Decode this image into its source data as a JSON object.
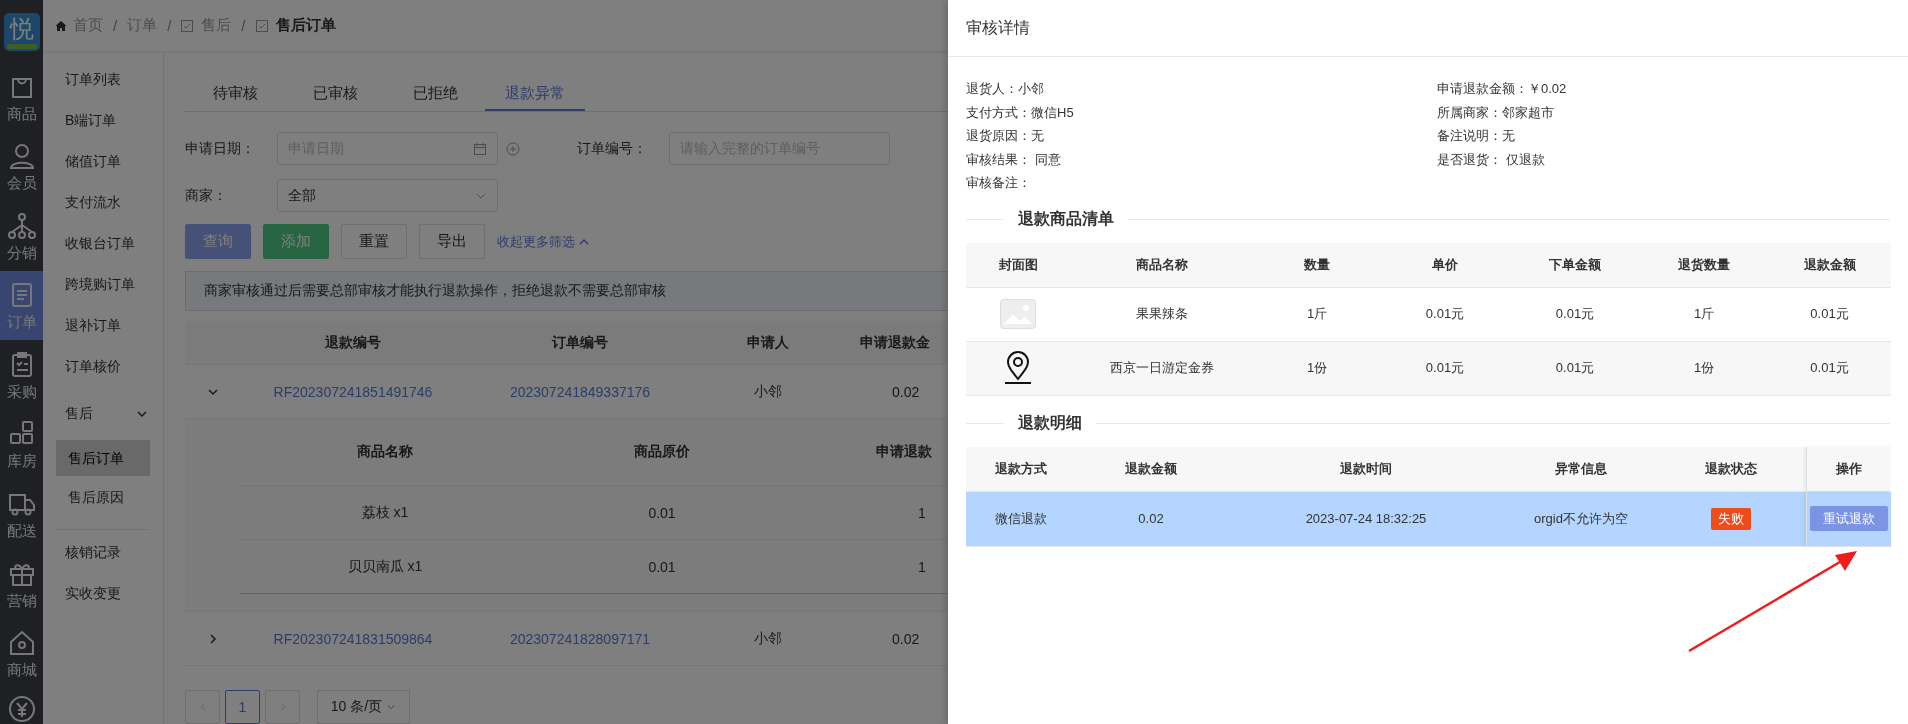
{
  "sidebar": {
    "logo": "悦",
    "items": [
      {
        "label": "商品",
        "selected": false
      },
      {
        "label": "会员",
        "selected": false
      },
      {
        "label": "分销",
        "selected": false
      },
      {
        "label": "订单",
        "selected": true
      },
      {
        "label": "采购",
        "selected": false
      },
      {
        "label": "库房",
        "selected": false
      },
      {
        "label": "配送",
        "selected": false
      },
      {
        "label": "营销",
        "selected": false
      },
      {
        "label": "商城",
        "selected": false
      }
    ]
  },
  "breadcrumb_separator": "/",
  "breadcrumb": [
    {
      "label": "首页",
      "kind": "home",
      "current": false
    },
    {
      "label": "订单",
      "kind": "plain",
      "current": false
    },
    {
      "label": "售后",
      "kind": "check",
      "current": false
    },
    {
      "label": "售后订单",
      "kind": "check",
      "current": true
    }
  ],
  "sub_menu": {
    "sections": [
      {
        "items": [
          {
            "label": "订单列表",
            "selected": false
          },
          {
            "label": "B端订单",
            "selected": false
          },
          {
            "label": "储值订单",
            "selected": false
          },
          {
            "label": "支付流水",
            "selected": false
          },
          {
            "label": "收银台订单",
            "selected": false
          },
          {
            "label": "跨境购订单",
            "selected": false
          },
          {
            "label": "退补订单",
            "selected": false
          },
          {
            "label": "订单核价",
            "selected": false
          },
          {
            "label": "售后",
            "expanded": true,
            "children": [
              {
                "label": "售后订单",
                "selected": true
              },
              {
                "label": "售后原因",
                "selected": false
              }
            ]
          }
        ]
      },
      {
        "items": [
          {
            "label": "核销记录",
            "selected": false
          },
          {
            "label": "实收变更",
            "selected": false
          }
        ]
      }
    ]
  },
  "tabs": [
    {
      "label": "待审核",
      "selected": false
    },
    {
      "label": "已审核",
      "selected": false
    },
    {
      "label": "已拒绝",
      "selected": false
    },
    {
      "label": "退款异常",
      "selected": true
    }
  ],
  "filters": {
    "date_label": "申请日期：",
    "date_placeholder": "申请日期",
    "order_label": "订单编号：",
    "order_placeholder": "请输入完整的订单编号",
    "merchant_label": "商家：",
    "merchant_value": "全部"
  },
  "buttons": [
    {
      "label": "查询",
      "kind": "primary"
    },
    {
      "label": "添加",
      "kind": "success"
    },
    {
      "label": "重置",
      "kind": "default"
    },
    {
      "label": "导出",
      "kind": "default"
    }
  ],
  "collapse_link": "收起更多筛选",
  "notice": "商家审核通过后需要总部审核才能执行退款操作，拒绝退款不需要总部审核",
  "table": {
    "columns": [
      "退款编号",
      "订单编号",
      "申请人",
      "申请退款金"
    ],
    "rows": [
      {
        "refund_no": "RF202307241851491746",
        "order_no": "202307241849337176",
        "applicant": "小邻",
        "amount": "0.02",
        "expanded": true,
        "detail": {
          "columns": [
            "商品名称",
            "商品原价",
            "申请退款"
          ],
          "rows": [
            {
              "name": "荔枝 x1",
              "price": "0.01",
              "qty": "1"
            },
            {
              "name": "贝贝南瓜 x1",
              "price": "0.01",
              "qty": "1"
            }
          ]
        }
      },
      {
        "refund_no": "RF202307241831509864",
        "order_no": "202307241828097171",
        "applicant": "小邻",
        "amount": "0.02",
        "expanded": false
      }
    ]
  },
  "pagination": {
    "pages": [
      {
        "label": "1",
        "selected": true
      }
    ],
    "page_size": "10 条/页"
  },
  "drawer": {
    "title": "审核详情",
    "info_left": [
      {
        "label": "退货人：",
        "value": "小邻"
      },
      {
        "label": "支付方式：",
        "value": "微信H5"
      },
      {
        "label": "退货原因：",
        "value": "无"
      },
      {
        "label": "审核结果：",
        "value": " 同意"
      },
      {
        "label": "审核备注："
      }
    ],
    "info_right": [
      {
        "label": "申请退款金额：",
        "value": "￥0.02"
      },
      {
        "label": "所属商家：",
        "value": "邻家超市"
      },
      {
        "label": "备注说明：",
        "value": "无"
      },
      {
        "label": "是否退货：",
        "value": " 仅退款"
      }
    ],
    "goods_title": "退款商品清单",
    "goods_columns": [
      "封面图",
      "商品名称",
      "数量",
      "单价",
      "下单金额",
      "退货数量",
      "退款金额"
    ],
    "goods_rows": [
      {
        "cover": {
          "kind": "image"
        },
        "name": "果果辣条",
        "qty": "1斤",
        "unit_price": "0.01元",
        "order_amount": "0.01元",
        "return_qty": "1斤",
        "refund_amount": "0.01元"
      },
      {
        "cover": {
          "kind": "pin"
        },
        "name": "西京一日游定金券",
        "qty": "1份",
        "unit_price": "0.01元",
        "order_amount": "0.01元",
        "return_qty": "1份",
        "refund_amount": "0.01元"
      }
    ],
    "refund_title": "退款明细",
    "refund_columns": [
      "退款方式",
      "退款金额",
      "退款时间",
      "异常信息",
      "退款状态",
      "操作"
    ],
    "refund_rows": [
      {
        "method": "微信退款",
        "amount": "0.02",
        "time": "2023-07-24 18:32:25",
        "error": "orgid不允许为空",
        "status": {
          "text": "失败",
          "kind": "danger"
        },
        "action": "重试退款",
        "selected": true
      }
    ]
  }
}
